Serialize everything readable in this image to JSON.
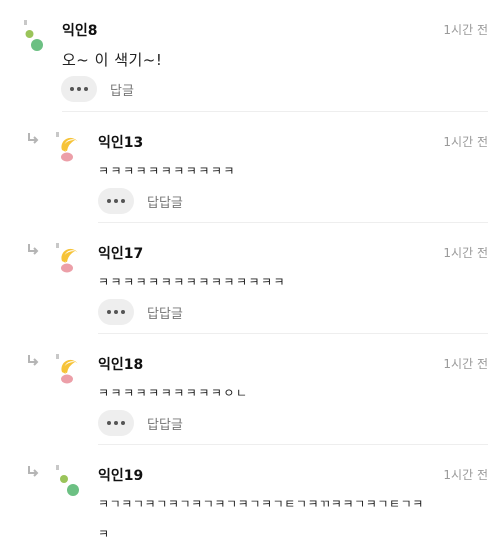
{
  "comments": [
    {
      "author": "익인8",
      "time": "1시간 전",
      "text": "오~ 이 색기~!",
      "reply_label": "답글",
      "is_reply": false,
      "avatar": "dots"
    },
    {
      "author": "익인13",
      "time": "1시간 전",
      "text": "ㅋㅋㅋㅋㅋㅋㅋㅋㅋㅋㅋ",
      "reply_label": "답답글",
      "is_reply": true,
      "avatar": "moon"
    },
    {
      "author": "익인17",
      "time": "1시간 전",
      "text": "ㅋㅋㅋㅋㅋㅋㅋㅋㅋㅋㅋㅋㅋㅋㅋ",
      "reply_label": "답답글",
      "is_reply": true,
      "avatar": "moon"
    },
    {
      "author": "익인18",
      "time": "1시간 전",
      "text": "ㅋㅋㅋㅋㅋㅋㅋㅋㅋㅋㅇㄴ",
      "reply_label": "답답글",
      "is_reply": true,
      "avatar": "moon"
    },
    {
      "author": "익인19",
      "time": "1시간 전",
      "text": "ㅋㄱㅋㄱㅋㄱㅋㄱㅋㄱㅋㄱㅋㄱㅋㄱㅌㄱㅋㄲㅋㅋㄱㅋㄱㅌㄱㅋ",
      "text_line2": "ㅋ",
      "is_reply": true,
      "avatar": "dots"
    }
  ],
  "colors": {
    "avatar_green_light": "#9ac45a",
    "avatar_green": "#6cc083",
    "avatar_yellow": "#f6c338",
    "avatar_pink": "#ec9fa8",
    "divider": "#eeeeee",
    "time_text": "#9a9a9a"
  },
  "icons": {
    "reply": "reply-arrow-icon",
    "more": "more-dots-icon"
  }
}
